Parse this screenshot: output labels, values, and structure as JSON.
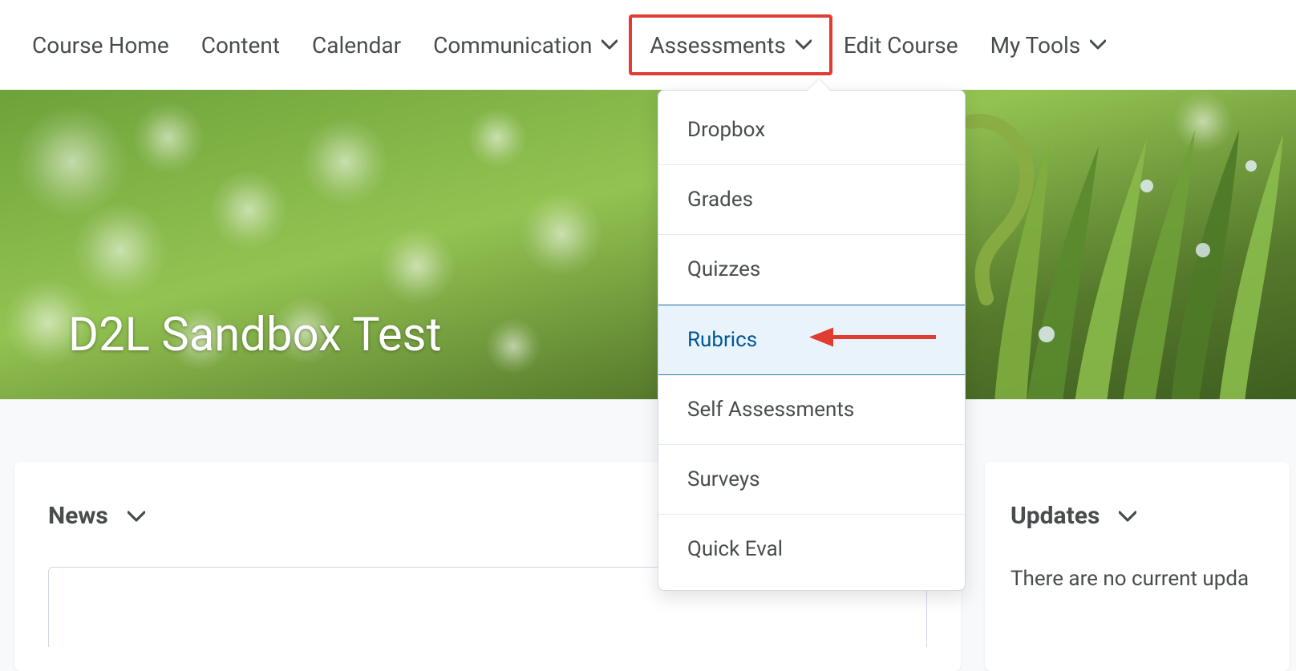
{
  "nav": {
    "items": [
      {
        "label": "Course Home",
        "has_dropdown": false,
        "highlight": false
      },
      {
        "label": "Content",
        "has_dropdown": false,
        "highlight": false
      },
      {
        "label": "Calendar",
        "has_dropdown": false,
        "highlight": false
      },
      {
        "label": "Communication",
        "has_dropdown": true,
        "highlight": false
      },
      {
        "label": "Assessments",
        "has_dropdown": true,
        "highlight": true
      },
      {
        "label": "Edit Course",
        "has_dropdown": false,
        "highlight": false
      },
      {
        "label": "My Tools",
        "has_dropdown": true,
        "highlight": false
      }
    ]
  },
  "dropdown": {
    "items": [
      {
        "label": "Dropbox",
        "active": false
      },
      {
        "label": "Grades",
        "active": false
      },
      {
        "label": "Quizzes",
        "active": false
      },
      {
        "label": "Rubrics",
        "active": true
      },
      {
        "label": "Self Assessments",
        "active": false
      },
      {
        "label": "Surveys",
        "active": false
      },
      {
        "label": "Quick Eval",
        "active": false
      }
    ]
  },
  "banner": {
    "title": "D2L Sandbox Test"
  },
  "cards": {
    "news": {
      "title": "News"
    },
    "updates": {
      "title": "Updates",
      "body": "There are no current upda"
    }
  },
  "colors": {
    "highlight_border": "#e03c31",
    "link_active": "#005694",
    "bg_active": "#e8f3fb"
  },
  "icons": {
    "chevron_down": "chevron-down-icon",
    "arrow_left": "arrow-left-annotation"
  }
}
